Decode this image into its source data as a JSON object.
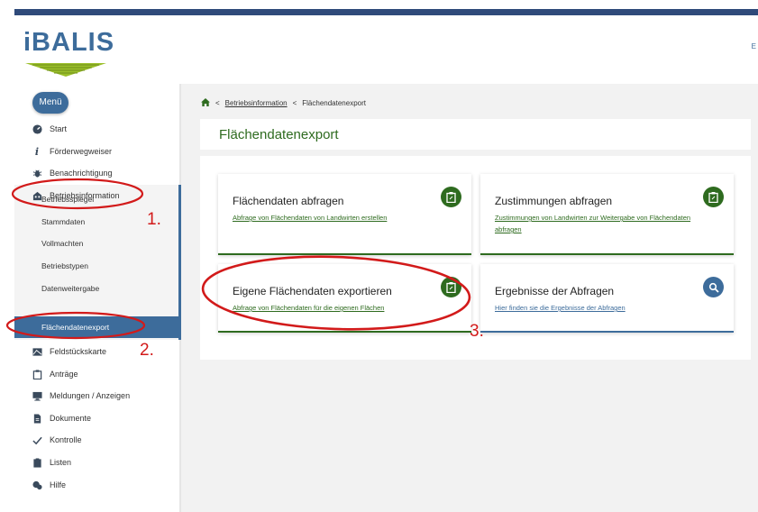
{
  "header": {
    "logo_text": "iBALIS",
    "right_text": "E"
  },
  "sidebar": {
    "menu_label": "Menü",
    "items": [
      {
        "label": "Start",
        "icon": "dashboard-icon"
      },
      {
        "label": "Förderwegweiser",
        "icon": "info-icon"
      },
      {
        "label": "Benachrichtigung",
        "icon": "bug-icon"
      },
      {
        "label": "Betriebsinformation",
        "icon": "building-icon"
      },
      {
        "label": "Feldstückskarte",
        "icon": "map-icon"
      },
      {
        "label": "Anträge",
        "icon": "clipboard-icon"
      },
      {
        "label": "Meldungen / Anzeigen",
        "icon": "monitor-icon"
      },
      {
        "label": "Dokumente",
        "icon": "document-icon"
      },
      {
        "label": "Kontrolle",
        "icon": "check-icon"
      },
      {
        "label": "Listen",
        "icon": "list-icon"
      },
      {
        "label": "Hilfe",
        "icon": "help-icon"
      }
    ],
    "sub_items": [
      "Betriebsspiegel",
      "Stammdaten",
      "Vollmachten",
      "Betriebstypen",
      "Datenweitergabe"
    ],
    "active_sub": "Flächendatenexport"
  },
  "breadcrumb": {
    "link": "Betriebsinformation",
    "current": "Flächendatenexport",
    "separator": "<"
  },
  "page": {
    "title": "Flächendatenexport"
  },
  "cards": [
    {
      "title": "Flächendaten abfragen",
      "subtitle": "Abfrage von Flächendaten von Landwirten erstellen",
      "icon": "clipboard-icon",
      "color": "#2e6b1f"
    },
    {
      "title": "Zustimmungen abfragen",
      "subtitle": "Zustimmungen von Landwirten zur Weitergabe von Flächendaten abfragen",
      "icon": "clipboard-icon",
      "color": "#2e6b1f"
    },
    {
      "title": "Eigene Flächendaten exportieren",
      "subtitle": "Abfrage von Flächendaten für die eigenen Flächen",
      "icon": "clipboard-icon",
      "color": "#2e6b1f"
    },
    {
      "title": "Ergebnisse der Abfragen",
      "subtitle": "Hier finden sie die Ergebnisse der Abfragen",
      "icon": "search-icon",
      "color": "#3d6c9b"
    }
  ],
  "annotations": {
    "step1": "1.",
    "step2": "2.",
    "step3": "3."
  },
  "colors": {
    "primary_blue": "#3d6c9b",
    "primary_green": "#2e6b1f",
    "annotation_red": "#d21a1a"
  }
}
